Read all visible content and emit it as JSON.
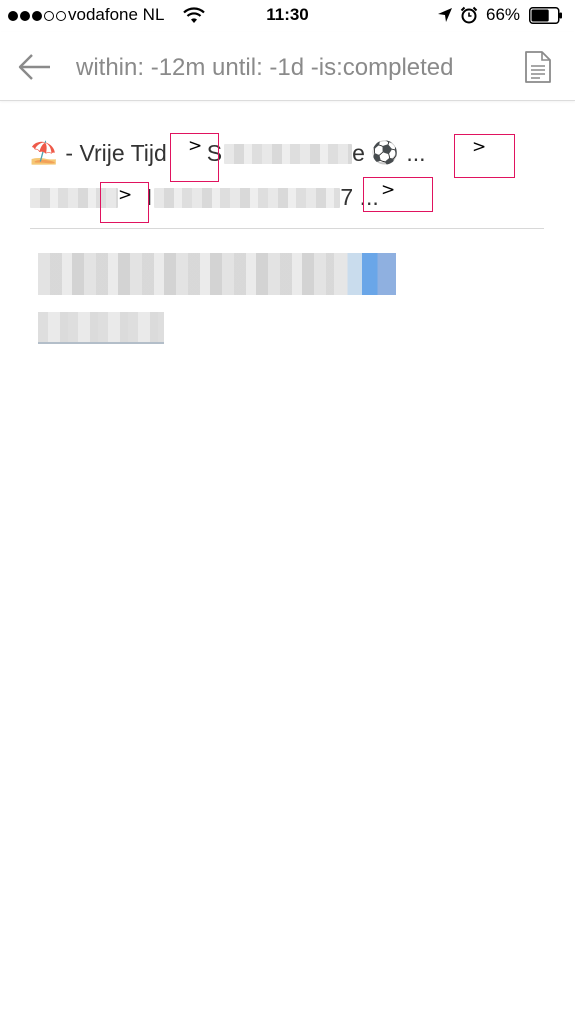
{
  "status_bar": {
    "carrier": "vodafone NL",
    "time": "11:30",
    "battery_percent": "66%",
    "signal_bars_filled": 3,
    "signal_bars_total": 5,
    "battery_level": 0.66
  },
  "top_nav": {
    "back_icon": "arrow-left-icon",
    "search_query": "within: -12m until: -1d -is:completed",
    "document_icon": "document-icon"
  },
  "result": {
    "line1_prefix_emoji": "⛱️",
    "line1_text": "- Vrije Tijd",
    "line1_letter": "S",
    "line1_suffix_char": "e",
    "line1_emoji": "⚽",
    "line1_ellipsis": "...",
    "line2_fragment": "7 ...",
    "line2_letter": "I",
    "nav_symbol": ">"
  },
  "colors": {
    "accent_box": "#e0135f",
    "search_text": "#8a8a8a",
    "divider": "#d8d8d8"
  }
}
